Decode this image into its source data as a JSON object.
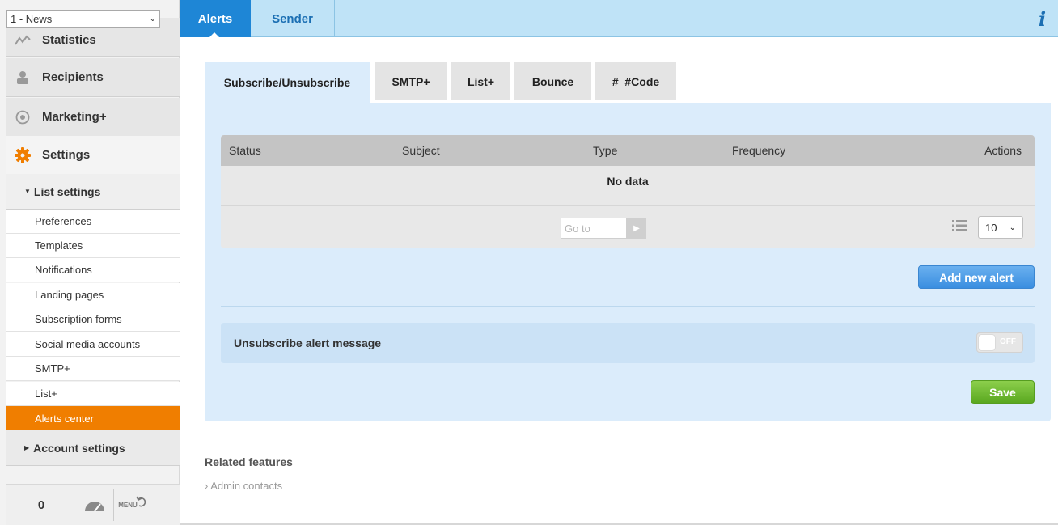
{
  "list_select": {
    "value": "1 - News"
  },
  "sidebar": {
    "statistics": "Statistics",
    "recipients": "Recipients",
    "marketing": "Marketing+",
    "settings": "Settings",
    "list_settings": "List settings",
    "leaves": [
      "Preferences",
      "Templates",
      "Notifications",
      "Landing pages",
      "Subscription forms",
      "Social media accounts",
      "SMTP+",
      "List+",
      "Alerts center"
    ],
    "account_settings": "Account settings",
    "footer_count": "0",
    "menu_label": "MENU"
  },
  "top_tabs": {
    "alerts": "Alerts",
    "sender": "Sender",
    "info": "i"
  },
  "sub_tabs": [
    "Subscribe/Unsubscribe",
    "SMTP+",
    "List+",
    "Bounce",
    "#_#Code"
  ],
  "grid": {
    "columns": [
      "Status",
      "Subject",
      "Type",
      "Frequency",
      "Actions"
    ],
    "empty_text": "No data",
    "goto_placeholder": "Go to",
    "per_page": "10"
  },
  "buttons": {
    "add_alert": "Add new alert",
    "save": "Save"
  },
  "unsubscribe": {
    "label": "Unsubscribe alert message",
    "toggle_state": "OFF"
  },
  "related": {
    "title": "Related features",
    "link": "› Admin contacts"
  },
  "colors": {
    "accent_orange": "#f07e00",
    "tab_blue": "#1e86d6",
    "panel_bg": "#dbecfb",
    "save_green": "#5aa820"
  },
  "icons": [
    "chevron-down-icon",
    "chart-icon",
    "person-icon",
    "target-icon",
    "gear-icon",
    "speedometer-icon",
    "menu-undo-icon",
    "info-icon",
    "play-icon",
    "list-icon"
  ]
}
